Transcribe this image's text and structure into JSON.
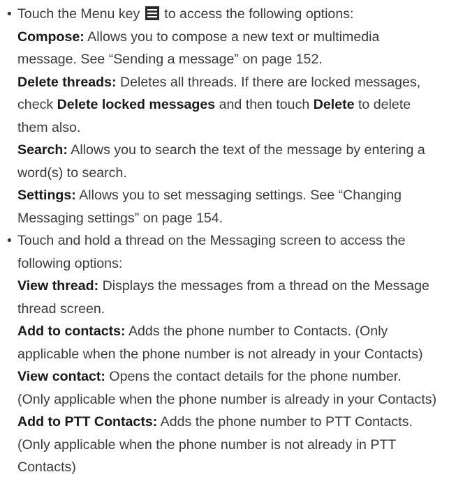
{
  "bullet_char": "•",
  "section1": {
    "intro_before_icon": "Touch the Menu key",
    "intro_after_icon": "to access the following options:",
    "items": [
      {
        "term": "Compose:",
        "line1": " Allows you to compose a new text or multimedia",
        "line2": "message. See “Sending a message” on page 152."
      },
      {
        "term": "Delete threads:",
        "line1": " Deletes all threads. If there are locked messages,",
        "line2_prefix": "check ",
        "line2_bold1": "Delete locked messages",
        "line2_mid": " and then touch ",
        "line2_bold2": "Delete",
        "line2_suffix": " to delete",
        "line3": "them also."
      },
      {
        "term": "Search:",
        "line1": " Allows you to search the text of the message by entering a",
        "line2": "word(s) to search."
      },
      {
        "term": "Settings:",
        "line1": " Allows you to set messaging settings. See “Changing",
        "line2": "Messaging settings” on page 154."
      }
    ]
  },
  "section2": {
    "intro_line1": "Touch and hold a thread on the Messaging screen to access the",
    "intro_line2": "following options:",
    "items": [
      {
        "term": "View thread:",
        "line1": " Displays the messages from a thread on the Message",
        "line2": "thread screen."
      },
      {
        "term": "Add to contacts:",
        "line1": " Adds the phone number to Contacts. (Only",
        "line2": "applicable when the phone number is not already in your Contacts)"
      },
      {
        "term": "View contact:",
        "line1": " Opens the contact details for the phone number.",
        "line2": "(Only applicable when the phone number is already in your Contacts)"
      },
      {
        "term": "Add to PTT Contacts:",
        "line1": " Adds the phone number to PTT Contacts.",
        "line2": "(Only applicable when the phone number is not already in PTT",
        "line3": "Contacts)"
      }
    ]
  },
  "icons": {
    "menu_key": "menu-key-icon"
  },
  "colors": {
    "text": "#3a3a3a",
    "bold_text": "#1a1a1a"
  }
}
